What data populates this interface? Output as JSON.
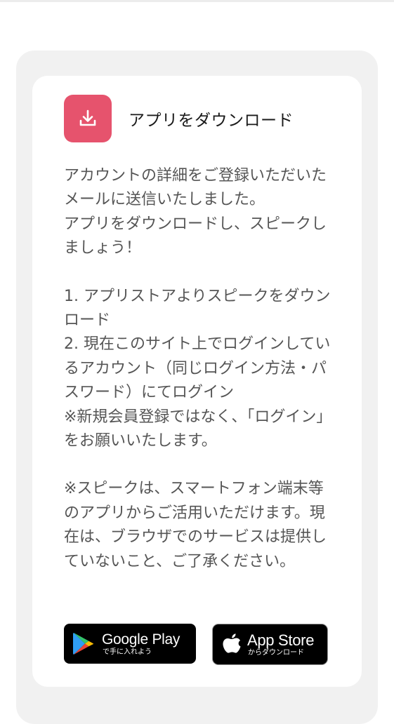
{
  "card": {
    "icon": "download-icon",
    "title": "アプリをダウンロード",
    "paragraphs": [
      "アカウントの詳細をご登録いただいたメールに送信いたしました。\nアプリをダウンロードし、スピークしましょう！",
      "1. アプリストアよりスピークをダウンロード\n2. 現在このサイト上でログインしているアカウント（同じログイン方法・パスワード）にてログイン\n※新規会員登録ではなく、「ログイン」をお願いいたします。",
      "※スピークは、スマートフォン端末等のアプリからご活用いただけます。現在は、ブラウザでのサービスは提供していないこと、ご了承ください。"
    ]
  },
  "stores": {
    "google": {
      "icon": "google-play-icon",
      "name": "Google Play",
      "sub": "で手に入れよう"
    },
    "apple": {
      "icon": "apple-icon",
      "name": "App Store",
      "sub": "からダウンロード"
    }
  },
  "colors": {
    "accent": "#e6536d",
    "panel_bg": "#f1f1f1",
    "card_bg": "#ffffff",
    "text": "#555555",
    "badge_bg": "#000000"
  }
}
